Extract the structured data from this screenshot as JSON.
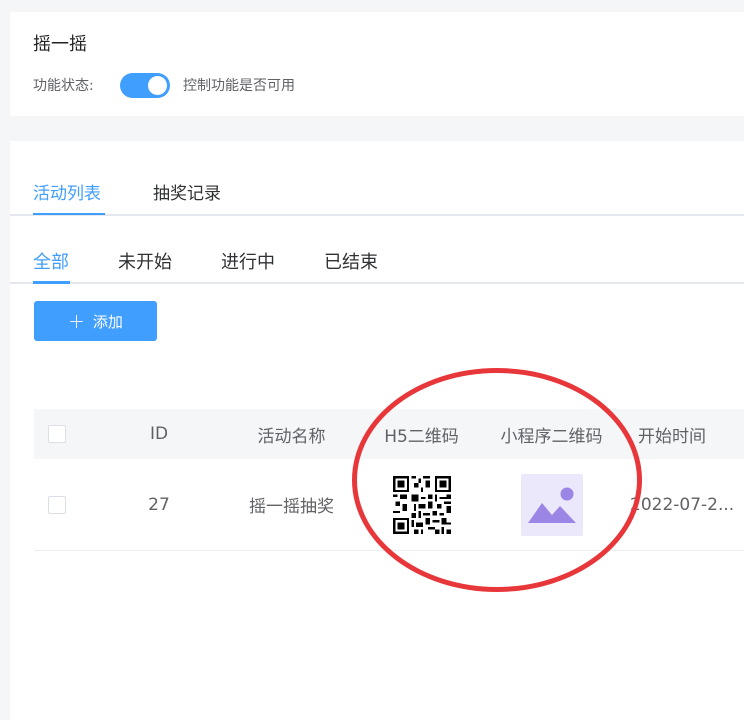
{
  "feature": {
    "title": "摇一摇",
    "status_label": "功能状态:",
    "status_on": true,
    "hint": "控制功能是否可用"
  },
  "tabs_primary": [
    "活动列表",
    "抽奖记录"
  ],
  "tabs_secondary": [
    "全部",
    "未开始",
    "进行中",
    "已结束"
  ],
  "add_button": {
    "icon": "plus-icon",
    "label": "添加"
  },
  "table": {
    "columns": [
      "ID",
      "活动名称",
      "H5二维码",
      "小程序二维码",
      "开始时间"
    ],
    "rows": [
      {
        "id": "27",
        "name": "摇一摇抽奖",
        "h5_qr": "qr-code-icon",
        "mini_qr": "image-placeholder-icon",
        "start": "2022-07-2..."
      }
    ]
  },
  "colors": {
    "accent": "#409eff",
    "annotation": "#e8373a",
    "placeholder_bg": "#ece8fb",
    "placeholder_fg": "#9b86e6"
  }
}
